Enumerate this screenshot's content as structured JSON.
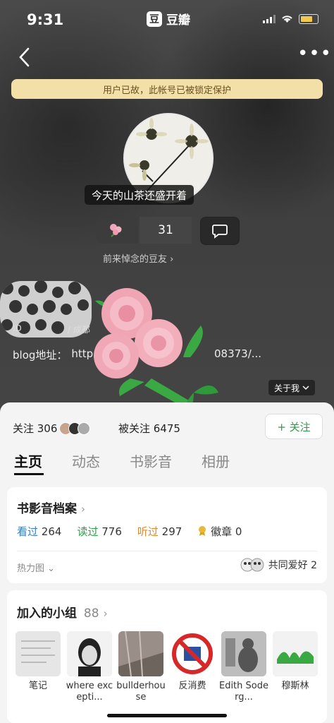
{
  "status_bar": {
    "time": "9:31",
    "app_title": "豆瓣",
    "app_logo_char": "豆"
  },
  "banner": {
    "text": "用户已故，此帐号已被锁定保护"
  },
  "profile": {
    "motto": "今天的山茶还盛开着",
    "flower_count": "31",
    "visitors_link": "前来悼念的豆友 ›",
    "id_label": "ID",
    "city_label": "/ 成都",
    "blog_label": "blog地址：",
    "blog_url_start": "http",
    "blog_url_end": "08373/...",
    "about_label": "关于我"
  },
  "follow": {
    "following": "关注 306",
    "followers": "被关注 6475",
    "follow_button": "+ 关注"
  },
  "tabs": [
    {
      "label": "主页",
      "active": true
    },
    {
      "label": "动态",
      "active": false
    },
    {
      "label": "书影音",
      "active": false
    },
    {
      "label": "相册",
      "active": false
    }
  ],
  "archive": {
    "title": "书影音档案",
    "seen_label": "看过",
    "seen_count": "264",
    "read_label": "读过",
    "read_count": "776",
    "heard_label": "听过",
    "heard_count": "297",
    "badge_label": "徽章",
    "badge_count": "0",
    "heatmap_label": "热力图 ⌄",
    "shared_label": "共同爱好 2"
  },
  "groups": {
    "title": "加入的小组",
    "count": "88",
    "items": [
      {
        "name": "笔记"
      },
      {
        "name": "where excepti..."
      },
      {
        "name": "bullderhouse"
      },
      {
        "name": "反消费"
      },
      {
        "name": "Edith Soderg..."
      },
      {
        "name": "穆斯林"
      }
    ]
  }
}
